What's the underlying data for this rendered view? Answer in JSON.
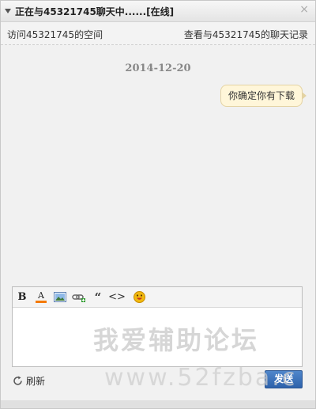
{
  "window": {
    "title": "正在与45321745聊天中......[在线]",
    "close_glyph": "×"
  },
  "links": {
    "visit_space": "访问45321745的空间",
    "view_history": "查看与45321745的聊天记录"
  },
  "messages": {
    "date": "2014-12-20",
    "items": [
      {
        "text": "你确定你有下载",
        "side": "right"
      }
    ]
  },
  "toolbar": {
    "bold": "B",
    "font_color": "A",
    "quote": "“",
    "code": "<>",
    "icons": [
      "bold-icon",
      "font-color-icon",
      "image-icon",
      "link-icon",
      "quote-icon",
      "code-icon",
      "emoji-icon"
    ],
    "font_color_accent": "#f47a00"
  },
  "compose": {
    "value": ""
  },
  "watermark": {
    "line1": "我爱辅助论坛",
    "line2": "www.52fzba.c"
  },
  "footer": {
    "refresh_label": "刷新",
    "send_label": "发送",
    "send_color": "#3a6fb9"
  }
}
